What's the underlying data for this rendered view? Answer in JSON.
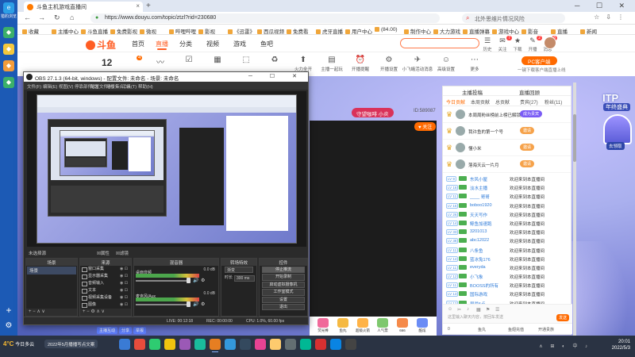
{
  "browser": {
    "sidebar_label": "猎豹浏览",
    "tab_title": "斗鱼主机游戏直播间",
    "tab_close": "×",
    "tab_add": "+",
    "window_controls": "─ ☐ ✕",
    "nav": {
      "back": "←",
      "forward": "→",
      "refresh": "↻",
      "home": "⌂"
    },
    "url": "https://www.douyu.com/topic/ztzl?rid=230680",
    "search_placeholder": "北外思维片情况风险",
    "bookmarks": [
      "收藏",
      "主播中心",
      "斗鱼直播",
      "免费影视",
      "微视",
      "哔哩哔哩",
      "影视",
      "《迅雷》",
      "西瓜视频",
      "免费看",
      "虎牙直播",
      "用户中心",
      "(84.00)",
      "制作中心",
      "大力游戏",
      "直播弹幕",
      "游戏中心",
      "影音",
      "直播",
      "新闻"
    ]
  },
  "site": {
    "logo": "斗鱼",
    "nav": [
      "首页",
      "直播",
      "分类",
      "视频",
      "游戏",
      "鱼吧"
    ],
    "active_nav": "直播",
    "header_icons": [
      {
        "glyph": "☰",
        "label": "历史"
      },
      {
        "glyph": "✉",
        "label": "关注",
        "badge": "7"
      },
      {
        "glyph": "★",
        "label": "下载"
      },
      {
        "glyph": "✎",
        "label": "开播",
        "badge": "2"
      },
      {
        "glyph": "◉",
        "label": "消息",
        "badge": "8"
      }
    ],
    "category_number": "12",
    "category_badge": "4",
    "categories": [
      {
        "glyph": "〰",
        "label": ""
      },
      {
        "glyph": "☑",
        "label": ""
      },
      {
        "glyph": "▦",
        "label": ""
      },
      {
        "glyph": "⬚",
        "label": ""
      },
      {
        "glyph": "♻",
        "label": ""
      },
      {
        "glyph": "⬆",
        "label": "火力全开"
      },
      {
        "glyph": "▤",
        "label": "主播一起玩"
      },
      {
        "glyph": "⏰",
        "label": "开播提醒"
      },
      {
        "glyph": "⚙",
        "label": "开播设置"
      },
      {
        "glyph": "✈",
        "label": "小飞蛾活动消息"
      },
      {
        "glyph": "☺",
        "label": "高级设置"
      },
      {
        "glyph": "⋯",
        "label": "更多"
      }
    ],
    "pc_client": "PC客户端",
    "pc_client_sub": "一键下载客户端直播上线",
    "streamer_pill": "守望咖啡 小炎",
    "fans_id": "ID:589087",
    "follow": "♥ 关注",
    "gifts": [
      {
        "label": "荧光棒",
        "color": "#f06a9a"
      },
      {
        "label": "鱼丸",
        "color": "#f5b942"
      },
      {
        "label": "超级火箭",
        "color": "#ffb347"
      },
      {
        "label": "人气票",
        "color": "#7ec86e"
      },
      {
        "label": "666",
        "color": "#f58a4a"
      },
      {
        "label": "酷炫",
        "color": "#6a8cf5"
      }
    ],
    "bottom_tags": [
      "主播互动",
      "分享",
      "举报"
    ]
  },
  "chat": {
    "head_left": "主播投稿",
    "head_right": "直播回顾",
    "tabs": [
      "今日贡献",
      "本周贡献",
      "总贡献",
      "贵宾(27)",
      "粉丝(11)"
    ],
    "active_tab": "今日贡献",
    "ranks": [
      {
        "name": "本周周粉丝榜前上榜已解锁前3名",
        "tag": "成为贵宾"
      },
      {
        "name": "我许鱼的第一个号",
        "tag": "邀请"
      },
      {
        "name": "懂小米",
        "tag": "邀请"
      },
      {
        "name": "落海天云一片月",
        "tag": "邀请"
      }
    ],
    "messages": [
      {
        "lv": "LV 9",
        "user": "东风小屋",
        "text": "欢迎来到本直播间"
      },
      {
        "lv": "LV 16",
        "user": "淡水主播",
        "text": "欢迎来到本直播间"
      },
      {
        "lv": "LV 11",
        "user": "____ 哥哥",
        "text": "欢迎来到本直播间"
      },
      {
        "lv": "LV 15",
        "user": "boboo1920",
        "text": "欢迎来到本直播间"
      },
      {
        "lv": "LV 26",
        "user": "天天写作",
        "text": "欢迎来到本直播间"
      },
      {
        "lv": "LV 14",
        "user": "鲸鱼加速跑",
        "text": "欢迎来到本直播间"
      },
      {
        "lv": "LV 33",
        "user": "3201013",
        "text": "欢迎来到本直播间"
      },
      {
        "lv": "LV 38",
        "user": "abc12022",
        "text": "欢迎来到本直播间"
      },
      {
        "lv": "LV 11",
        "user": "八条鱼",
        "text": "欢迎来到本直播间"
      },
      {
        "lv": "LV 14",
        "user": "蓝冰兔176",
        "text": "欢迎来到本直播间"
      },
      {
        "lv": "LV 11",
        "user": "everyda",
        "text": "欢迎来到本直播间"
      },
      {
        "lv": "LV 12",
        "user": "小飞象",
        "text": "欢迎来到本直播间"
      },
      {
        "lv": "LV 11",
        "user": "BOOSS的所有",
        "text": "欢迎来到本直播间"
      },
      {
        "lv": "LV 13",
        "user": "国际游戏",
        "text": "欢迎来到本直播间"
      },
      {
        "lv": "LV 12",
        "user": "早晨5点",
        "text": "欢迎来到本直播间"
      },
      {
        "lv": "LV 13",
        "user": "我的心的东西",
        "text": "欢迎来到本直播间"
      },
      {
        "lv": "LV 14",
        "user": "胡同小猫8234",
        "text": "欢迎来到本直播间"
      }
    ],
    "input_placeholder": "这里输入聊天内容，按回车发送",
    "send": "发送",
    "input_icons": [
      "☺",
      "✂",
      "♪",
      "▦",
      "⚑",
      "☰"
    ],
    "foot": [
      "0",
      "鱼丸",
      "鱼翅充值",
      "开通贵族"
    ]
  },
  "side_promo": {
    "title": "ITP",
    "subtitle": "年终盛典",
    "cta": "去领取"
  },
  "obs": {
    "title": "OBS 27.1.3 (64-bit, windows) - 配置文件: 未命名 - 场景: 未命名",
    "window_controls": "─ ☐ ✕",
    "menu": [
      "文件(F)",
      "编辑(E)",
      "视图(V)",
      "停靠部件(D)",
      "配置文件(P)",
      "场景集合(S)",
      "工具(T)",
      "帮助(H)"
    ],
    "tabs": [
      "未选择源",
      "☒属性",
      "☒滤镜"
    ],
    "docks": {
      "scenes": "场景",
      "sources": "来源",
      "mixer": "混音器",
      "transitions": "转场特效",
      "controls": "控件"
    },
    "scene_list": [
      "场景"
    ],
    "source_list": [
      "窗口采集",
      "显示器采集",
      "音频输入",
      "文本",
      "视频采集设备",
      "图像"
    ],
    "mixer": [
      {
        "name": "桌面音频",
        "db": "0.0 dB"
      },
      {
        "name": "麦克风/Aux",
        "db": "0.0 dB"
      }
    ],
    "transition": {
      "label": "渐变",
      "duration_label": "时长",
      "duration": "300 ms"
    },
    "controls": [
      "停止推流",
      "开始录制",
      "启动虚拟摄像机",
      "工作室模式",
      "设置",
      "退出"
    ],
    "status": [
      "LIVE: 00:12:18",
      "REC: 00:00:00",
      "CPU: 1.0%, 60.00 fps"
    ]
  },
  "taskbar": {
    "weather_temp": "4°C",
    "weather_text": "今日多云",
    "search": "2022年5月播播写点文案",
    "time": "20:01",
    "date": "2022/5/3",
    "tray": "∧ ⊞ ◐ 中 ♪"
  }
}
